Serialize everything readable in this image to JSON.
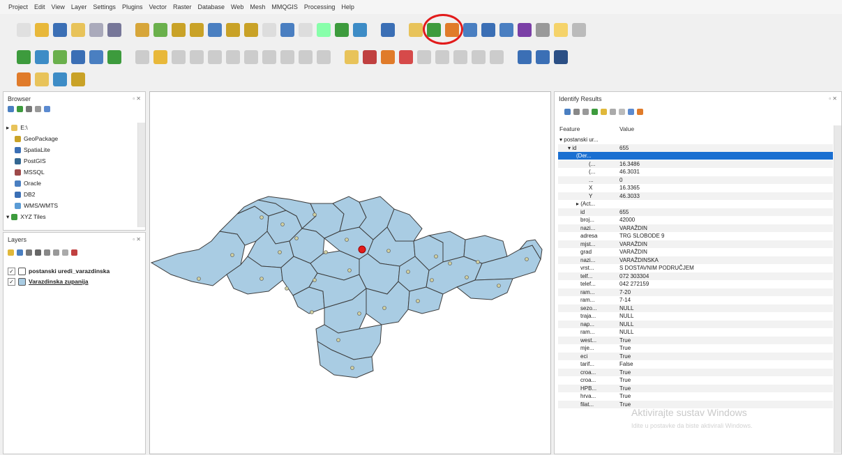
{
  "menu": [
    "Project",
    "Edit",
    "View",
    "Layer",
    "Settings",
    "Plugins",
    "Vector",
    "Raster",
    "Database",
    "Web",
    "Mesh",
    "MMQGIS",
    "Processing",
    "Help"
  ],
  "browser": {
    "title": "Browser",
    "items": [
      {
        "label": "E:\\",
        "icon": "folder-icon",
        "indent": 0,
        "expander": "▸"
      },
      {
        "label": "GeoPackage",
        "icon": "geopackage-icon",
        "indent": 1
      },
      {
        "label": "SpatiaLite",
        "icon": "spatialite-icon",
        "indent": 1
      },
      {
        "label": "PostGIS",
        "icon": "postgis-icon",
        "indent": 1
      },
      {
        "label": "MSSQL",
        "icon": "mssql-icon",
        "indent": 1
      },
      {
        "label": "Oracle",
        "icon": "oracle-icon",
        "indent": 1
      },
      {
        "label": "DB2",
        "icon": "db2-icon",
        "indent": 1
      },
      {
        "label": "WMS/WMTS",
        "icon": "wms-icon",
        "indent": 1
      },
      {
        "label": "XYZ Tiles",
        "icon": "xyz-icon",
        "indent": 0,
        "expander": "▾"
      }
    ]
  },
  "layers": {
    "title": "Layers",
    "items": [
      {
        "label": "postanski uredi_varazdinska",
        "checked": "✓",
        "icon": "point-layer-icon"
      },
      {
        "label": "Varazdinska zupanija",
        "checked": "✓",
        "icon": "polygon-layer-icon"
      }
    ]
  },
  "identify": {
    "title": "Identify Results",
    "col_feature": "Feature",
    "col_value": "Value",
    "rows": [
      {
        "f": "▾ postanski ur...",
        "v": "",
        "indent": 0
      },
      {
        "f": "▾ id",
        "v": "655",
        "indent": 2
      },
      {
        "f": "(Der...",
        "v": "",
        "indent": 4,
        "selected": true
      },
      {
        "f": "(...",
        "v": "16.3486",
        "indent": 7
      },
      {
        "f": "(...",
        "v": "46.3031",
        "indent": 7
      },
      {
        "f": "...",
        "v": "0",
        "indent": 7
      },
      {
        "f": "X",
        "v": "16.3365",
        "indent": 7
      },
      {
        "f": "Y",
        "v": "46.3033",
        "indent": 7
      },
      {
        "f": "▸ (Act...",
        "v": "",
        "indent": 4
      },
      {
        "f": "id",
        "v": "655",
        "indent": 5
      },
      {
        "f": "broj...",
        "v": "42000",
        "indent": 5
      },
      {
        "f": "nazi...",
        "v": "VARAŽDIN",
        "indent": 5
      },
      {
        "f": "adresa",
        "v": "TRG SLOBODE 9",
        "indent": 5
      },
      {
        "f": "mjst...",
        "v": "VARAŽDIN",
        "indent": 5
      },
      {
        "f": "grad",
        "v": "VARAŽDIN",
        "indent": 5
      },
      {
        "f": "nazi...",
        "v": "VARAŽDINSKA",
        "indent": 5
      },
      {
        "f": "vrst...",
        "v": "S DOSTAVNIM PODRUČJEM",
        "indent": 5
      },
      {
        "f": "telf...",
        "v": "072 303304",
        "indent": 5
      },
      {
        "f": "telef...",
        "v": "042 272159",
        "indent": 5
      },
      {
        "f": "ram...",
        "v": "7-20",
        "indent": 5
      },
      {
        "f": "ram...",
        "v": "7-14",
        "indent": 5
      },
      {
        "f": "sezo...",
        "v": "NULL",
        "indent": 5
      },
      {
        "f": "traja...",
        "v": "NULL",
        "indent": 5
      },
      {
        "f": "nap...",
        "v": "NULL",
        "indent": 5
      },
      {
        "f": "ram...",
        "v": "NULL",
        "indent": 5
      },
      {
        "f": "west...",
        "v": "True",
        "indent": 5
      },
      {
        "f": "mje...",
        "v": "True",
        "indent": 5
      },
      {
        "f": "eci",
        "v": "True",
        "indent": 5
      },
      {
        "f": "tarif...",
        "v": "False",
        "indent": 5
      },
      {
        "f": "croa...",
        "v": "True",
        "indent": 5
      },
      {
        "f": "croa...",
        "v": "True",
        "indent": 5
      },
      {
        "f": "HPB...",
        "v": "True",
        "indent": 5
      },
      {
        "f": "hrva...",
        "v": "True",
        "indent": 5
      },
      {
        "f": "filat...",
        "v": "True",
        "indent": 5
      }
    ]
  },
  "watermark": {
    "line1": "Aktivirajte sustav Windows",
    "line2": "Idite u postavke da biste aktivirali Windows."
  },
  "colors": {
    "polygon_fill": "#a9cce3",
    "polygon_stroke": "#3c3c3c",
    "selected_point": "#e21b1b",
    "selection_row": "#1a6fd1",
    "highlight_ring": "#e21b1b"
  }
}
